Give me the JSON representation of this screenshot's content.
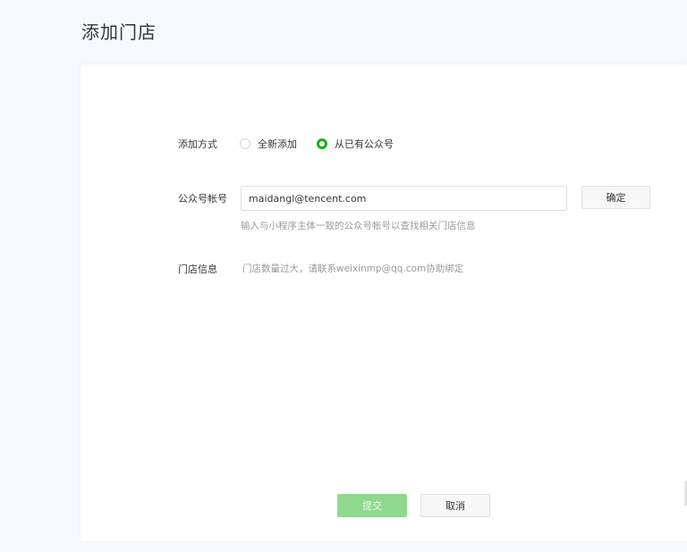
{
  "page": {
    "title": "添加门店"
  },
  "form": {
    "add_method": {
      "label": "添加方式",
      "options": [
        {
          "label": "全新添加",
          "selected": false
        },
        {
          "label": "从已有公众号",
          "selected": true
        }
      ]
    },
    "account": {
      "label": "公众号帐号",
      "value": "maidangl@tencent.com",
      "placeholder": "",
      "confirm_label": "确定",
      "hint": "输入与小程序主体一致的公众号帐号以查找相关门店信息"
    },
    "store_info": {
      "label": "门店信息",
      "message": "门店数量过大，请联系weixinmp@qq.com协助绑定"
    }
  },
  "actions": {
    "submit_label": "提交",
    "cancel_label": "取消"
  },
  "colors": {
    "brand_green": "#1aad19",
    "submit_disabled": "#8fd98f",
    "page_background": "#f5f8fc"
  }
}
